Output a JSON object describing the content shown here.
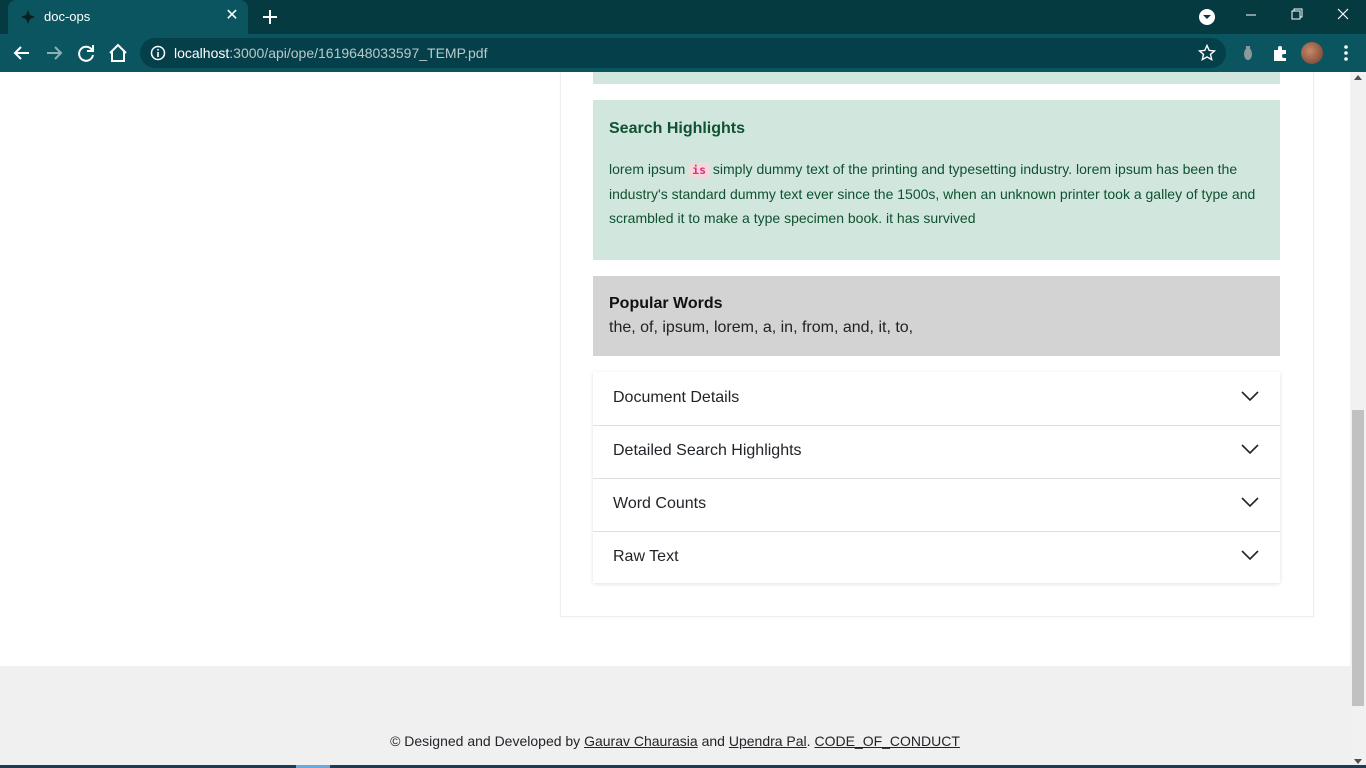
{
  "browser": {
    "tab_title": "doc-ops",
    "url_host": "localhost",
    "url_rest": ":3000/api/ope/1619648033597_TEMP.pdf"
  },
  "highlights": {
    "title": "Search Highlights",
    "text_before": "lorem ipsum ",
    "mark": "is",
    "text_after": " simply dummy text of the printing and typesetting industry. lorem ipsum has been the industry's standard dummy text ever since the 1500s, when an unknown printer took a galley of type and scrambled it to make a type specimen book. it has survived"
  },
  "popular": {
    "title": "Popular Words",
    "words": "the, of, ipsum, lorem, a, in, from, and, it, to,"
  },
  "accordion": [
    {
      "label": "Document Details"
    },
    {
      "label": "Detailed Search Highlights"
    },
    {
      "label": "Word Counts"
    },
    {
      "label": "Raw Text"
    }
  ],
  "footer": {
    "prefix": "© Designed and Developed by ",
    "author1": "Gaurav Chaurasia",
    "and": " and ",
    "author2": "Upendra Pal",
    "sep": ". ",
    "coc": "CODE_OF_CONDUCT"
  },
  "colors": {
    "chrome_dark": "#053a40",
    "chrome_tab": "#0b5560",
    "highlight_bg": "#d1e7dd",
    "highlight_text": "#0f5132",
    "popular_bg": "#d3d3d3",
    "footer_bg": "#f0f0f0"
  }
}
